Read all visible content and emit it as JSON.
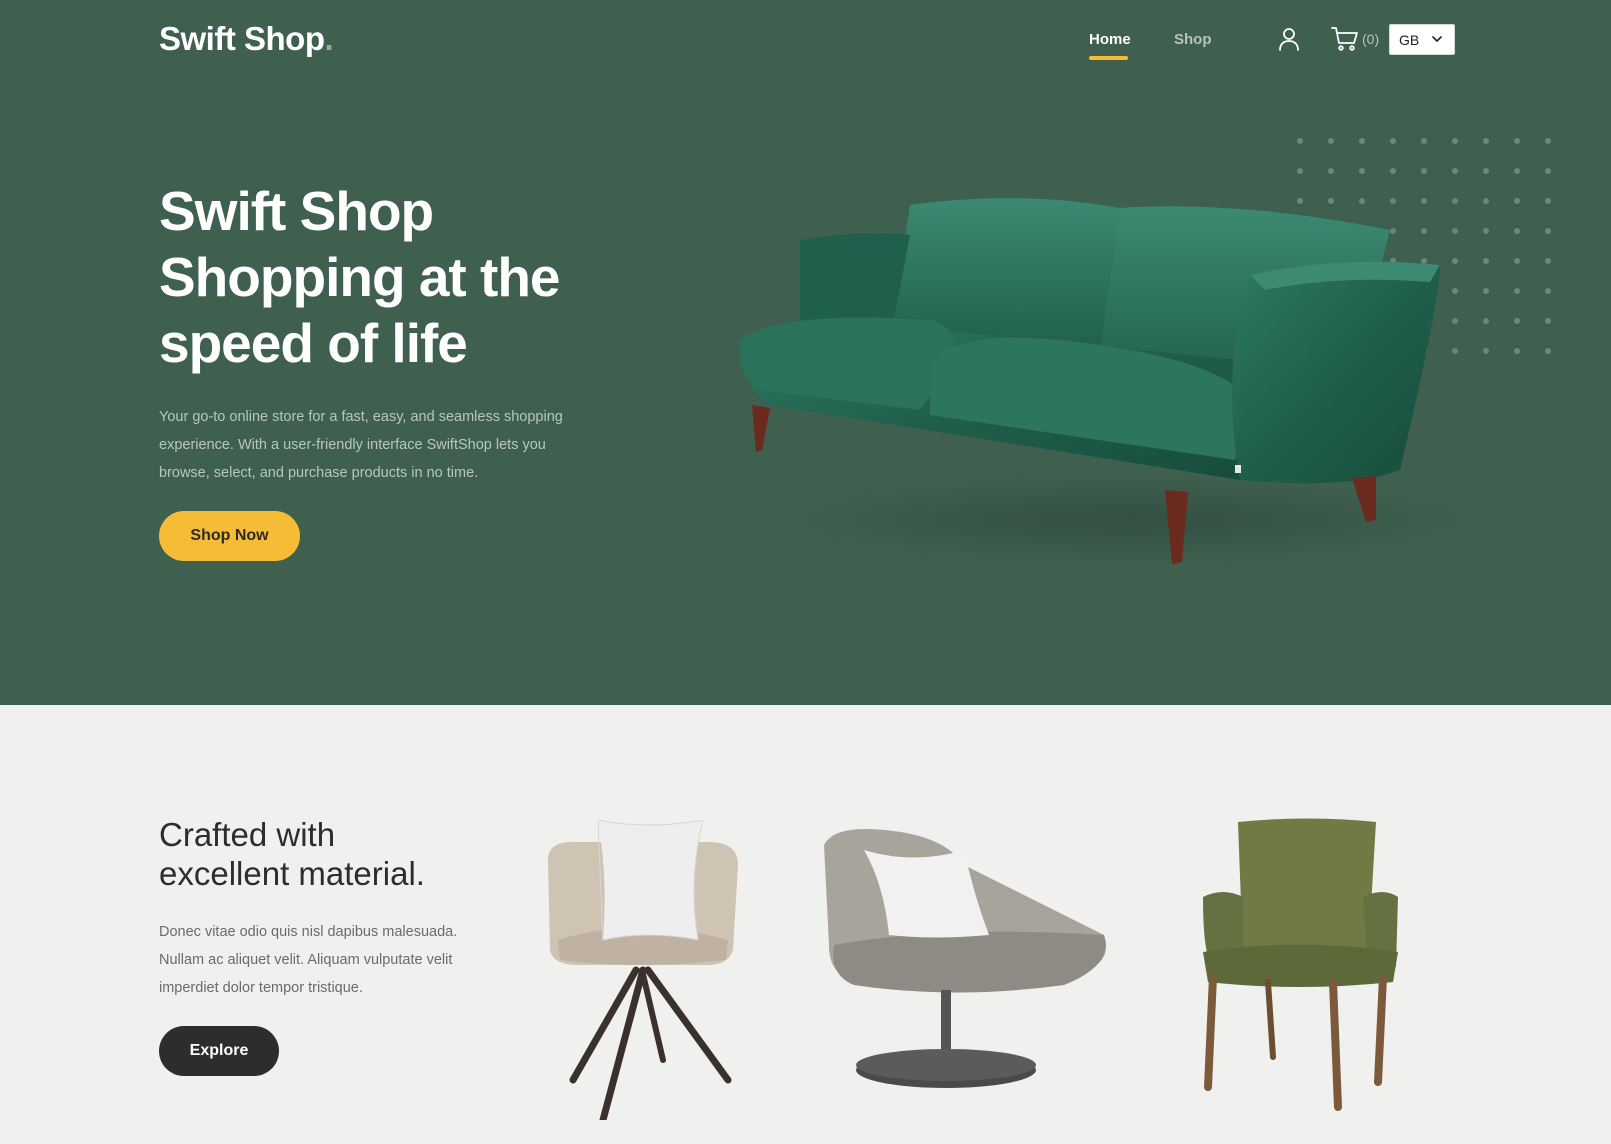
{
  "brand": {
    "name": "Swift Shop",
    "dot": "."
  },
  "nav": {
    "items": [
      {
        "label": "Home",
        "active": true
      },
      {
        "label": "Shop",
        "active": false
      }
    ],
    "cart_count": "(0)",
    "currency": {
      "selected": "GB"
    }
  },
  "hero": {
    "title_lines": [
      "Swift Shop",
      "Shopping at the",
      "speed of life"
    ],
    "description_lines": [
      "Your go-to online store for a fast, easy, and seamless shopping",
      "experience. With a user-friendly interface SwiftShop lets you",
      "browse, select, and purchase products in no time."
    ],
    "cta_label": "Shop Now",
    "image": "green-velvet-sofa"
  },
  "feature": {
    "title_lines": [
      "Crafted with",
      "excellent material."
    ],
    "description_lines": [
      "Donec vitae odio quis nisl dapibus malesuada.",
      "Nullam ac aliquet velit. Aliquam vulputate velit",
      "imperdiet dolor tempor tristique."
    ],
    "cta_label": "Explore",
    "products": [
      "beige-swivel-armchair",
      "grey-lounge-chair",
      "olive-dining-armchair"
    ]
  },
  "colors": {
    "hero_bg": "#3f5f4f",
    "accent": "#f6bc36",
    "section_bg": "#f0f0ef",
    "dark_button": "#2d2d2d",
    "muted_text": "#b9c6bf"
  },
  "icons": [
    "user-icon",
    "cart-icon",
    "chevron-down-icon"
  ]
}
